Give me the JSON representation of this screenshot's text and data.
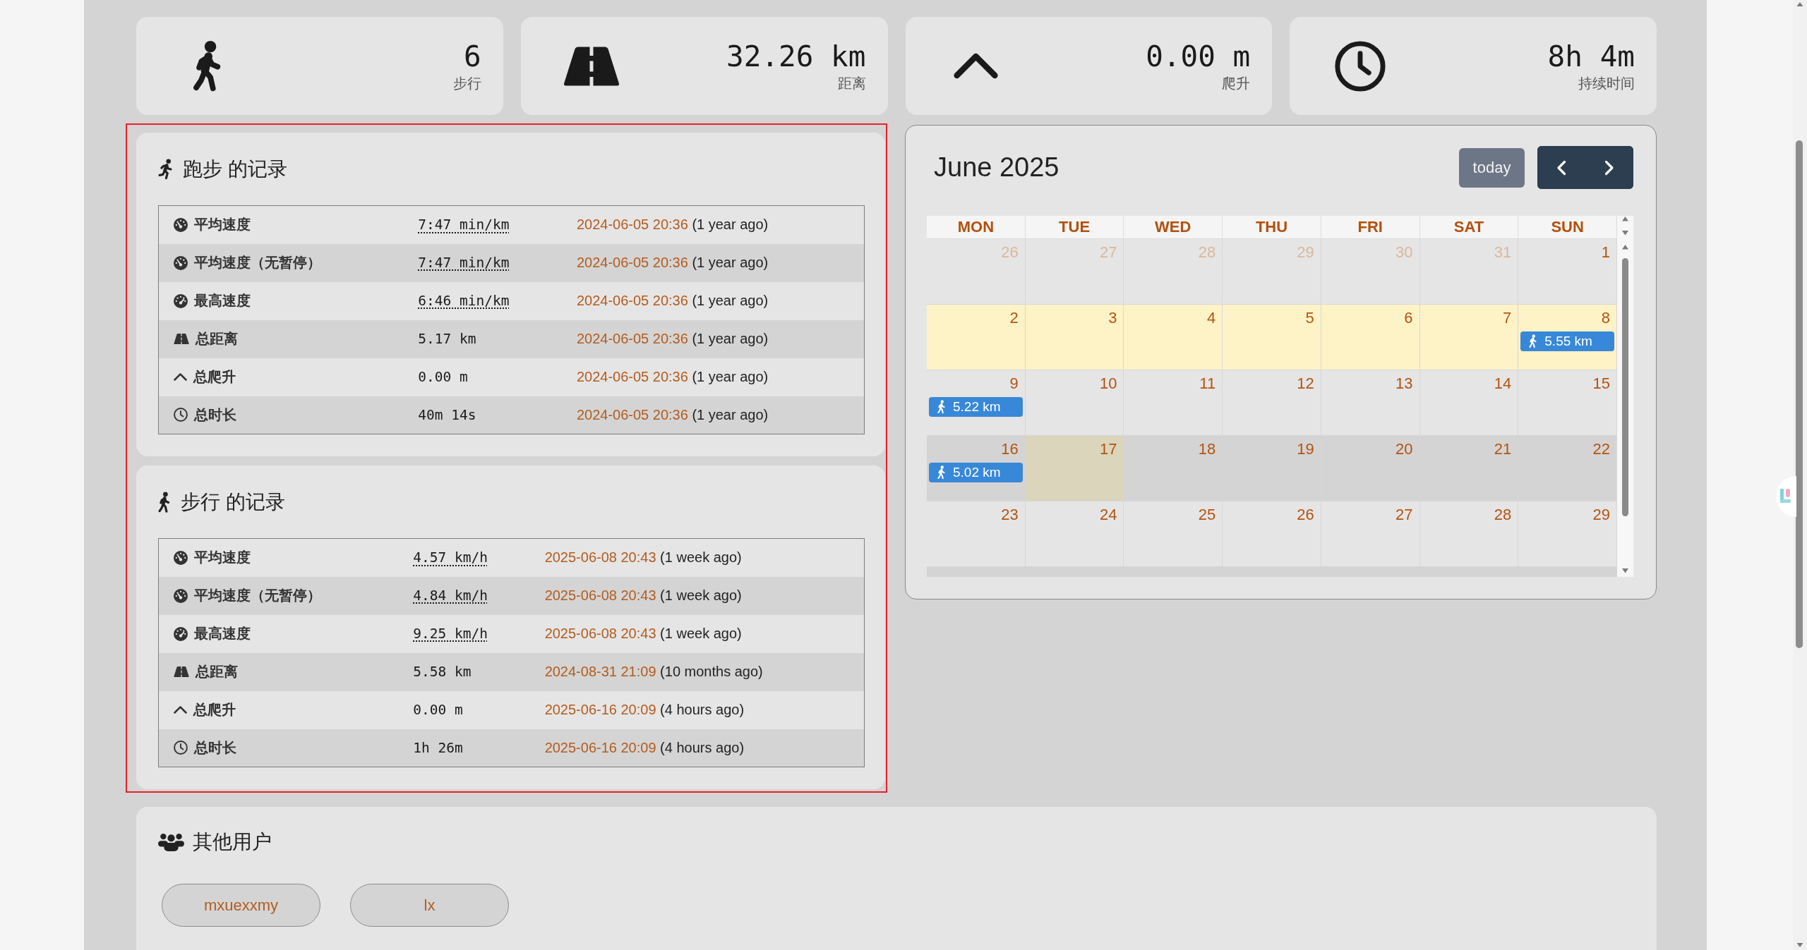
{
  "stats": [
    {
      "kind": "walk",
      "value": "6",
      "label": "步行"
    },
    {
      "kind": "distance",
      "value": "32.26 km",
      "label": "距离"
    },
    {
      "kind": "climb",
      "value": "0.00 m",
      "label": "爬升"
    },
    {
      "kind": "duration",
      "value": "8h 4m",
      "label": "持续时间"
    }
  ],
  "records": [
    {
      "kind": "run",
      "title": "跑步 的记录",
      "rows": [
        {
          "kind": "speed",
          "label": "平均速度",
          "value": "7:47 min/km",
          "underlined": true,
          "date": "2024-06-05 20:36",
          "ago": "(1 year ago)"
        },
        {
          "kind": "speed",
          "label": "平均速度（无暂停）",
          "value": "7:47 min/km",
          "underlined": true,
          "date": "2024-06-05 20:36",
          "ago": "(1 year ago)"
        },
        {
          "kind": "max_speed",
          "label": "最高速度",
          "value": "6:46 min/km",
          "underlined": true,
          "date": "2024-06-05 20:36",
          "ago": "(1 year ago)"
        },
        {
          "kind": "distance",
          "label": "总距离",
          "value": "5.17 km",
          "underlined": false,
          "date": "2024-06-05 20:36",
          "ago": "(1 year ago)"
        },
        {
          "kind": "climb",
          "label": "总爬升",
          "value": "0.00 m",
          "underlined": false,
          "date": "2024-06-05 20:36",
          "ago": "(1 year ago)"
        },
        {
          "kind": "duration",
          "label": "总时长",
          "value": "40m 14s",
          "underlined": false,
          "date": "2024-06-05 20:36",
          "ago": "(1 year ago)"
        }
      ]
    },
    {
      "kind": "walk",
      "title": "步行 的记录",
      "rows": [
        {
          "kind": "speed",
          "label": "平均速度",
          "value": "4.57 km/h",
          "underlined": true,
          "date": "2025-06-08 20:43",
          "ago": "(1 week ago)"
        },
        {
          "kind": "speed",
          "label": "平均速度（无暂停）",
          "value": "4.84 km/h",
          "underlined": true,
          "date": "2025-06-08 20:43",
          "ago": "(1 week ago)"
        },
        {
          "kind": "max_speed",
          "label": "最高速度",
          "value": "9.25 km/h",
          "underlined": true,
          "date": "2025-06-08 20:43",
          "ago": "(1 week ago)"
        },
        {
          "kind": "distance",
          "label": "总距离",
          "value": "5.58 km",
          "underlined": false,
          "date": "2024-08-31 21:09",
          "ago": "(10 months ago)"
        },
        {
          "kind": "climb",
          "label": "总爬升",
          "value": "0.00 m",
          "underlined": false,
          "date": "2025-06-16 20:09",
          "ago": "(4 hours ago)"
        },
        {
          "kind": "duration",
          "label": "总时长",
          "value": "1h 26m",
          "underlined": false,
          "date": "2025-06-16 20:09",
          "ago": "(4 hours ago)"
        }
      ]
    }
  ],
  "calendar": {
    "title": "June 2025",
    "today_label": "today",
    "weekdays": [
      "MON",
      "TUE",
      "WED",
      "THU",
      "FRI",
      "SAT",
      "SUN"
    ],
    "weeks": [
      {
        "kind": "plain",
        "days": [
          {
            "day": "26",
            "muted": true,
            "today": false
          },
          {
            "day": "27",
            "muted": true,
            "today": false
          },
          {
            "day": "28",
            "muted": true,
            "today": false
          },
          {
            "day": "29",
            "muted": true,
            "today": false
          },
          {
            "day": "30",
            "muted": true,
            "today": false
          },
          {
            "day": "31",
            "muted": true,
            "today": false
          },
          {
            "day": "1",
            "muted": false,
            "today": false
          }
        ]
      },
      {
        "kind": "highlight",
        "days": [
          {
            "day": "2",
            "muted": false,
            "today": false
          },
          {
            "day": "3",
            "muted": false,
            "today": false
          },
          {
            "day": "4",
            "muted": false,
            "today": false
          },
          {
            "day": "5",
            "muted": false,
            "today": false
          },
          {
            "day": "6",
            "muted": false,
            "today": false
          },
          {
            "day": "7",
            "muted": false,
            "today": false
          },
          {
            "day": "8",
            "muted": false,
            "today": false,
            "events": [
              {
                "kind": "walk",
                "label": "5.55 km"
              }
            ]
          }
        ]
      },
      {
        "kind": "plain",
        "days": [
          {
            "day": "9",
            "muted": false,
            "today": false,
            "events": [
              {
                "kind": "walk",
                "label": "5.22 km"
              }
            ]
          },
          {
            "day": "10",
            "muted": false,
            "today": false
          },
          {
            "day": "11",
            "muted": false,
            "today": false
          },
          {
            "day": "12",
            "muted": false,
            "today": false
          },
          {
            "day": "13",
            "muted": false,
            "today": false
          },
          {
            "day": "14",
            "muted": false,
            "today": false
          },
          {
            "day": "15",
            "muted": false,
            "today": false
          }
        ]
      },
      {
        "kind": "shaded",
        "days": [
          {
            "day": "16",
            "muted": false,
            "today": false,
            "events": [
              {
                "kind": "walk",
                "label": "5.02 km"
              }
            ]
          },
          {
            "day": "17",
            "muted": false,
            "today": true
          },
          {
            "day": "18",
            "muted": false,
            "today": false
          },
          {
            "day": "19",
            "muted": false,
            "today": false
          },
          {
            "day": "20",
            "muted": false,
            "today": false
          },
          {
            "day": "21",
            "muted": false,
            "today": false
          },
          {
            "day": "22",
            "muted": false,
            "today": false
          }
        ]
      },
      {
        "kind": "plain",
        "days": [
          {
            "day": "23",
            "muted": false,
            "today": false
          },
          {
            "day": "24",
            "muted": false,
            "today": false
          },
          {
            "day": "25",
            "muted": false,
            "today": false
          },
          {
            "day": "26",
            "muted": false,
            "today": false
          },
          {
            "day": "27",
            "muted": false,
            "today": false
          },
          {
            "day": "28",
            "muted": false,
            "today": false
          },
          {
            "day": "29",
            "muted": false,
            "today": false
          }
        ]
      }
    ]
  },
  "other_users": {
    "title": "其他用户",
    "users": [
      "mxuexxmy",
      "lx"
    ]
  }
}
